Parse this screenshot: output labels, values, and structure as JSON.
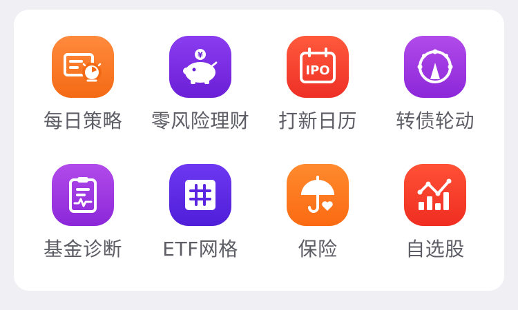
{
  "menu": {
    "items": [
      {
        "label": "每日策略",
        "icon": "strategy-card-icon",
        "color": "#f46a14"
      },
      {
        "label": "零风险理财",
        "icon": "piggy-bank-icon",
        "color": "#6b1fd6"
      },
      {
        "label": "打新日历",
        "icon": "ipo-calendar-icon",
        "color": "#ee2f26"
      },
      {
        "label": "转债轮动",
        "icon": "rotation-wheel-icon",
        "color": "#8c27d9"
      },
      {
        "label": "基金诊断",
        "icon": "clipboard-diagnosis-icon",
        "color": "#8c27d9"
      },
      {
        "label": "ETF网格",
        "icon": "grid-icon",
        "color": "#4f1ed8"
      },
      {
        "label": "保险",
        "icon": "umbrella-heart-icon",
        "color": "#fb6a12"
      },
      {
        "label": "自选股",
        "icon": "bar-trend-icon",
        "color": "#ef2d21"
      }
    ],
    "icon_texts": {
      "yen": "¥",
      "ipo": "IPO"
    }
  }
}
